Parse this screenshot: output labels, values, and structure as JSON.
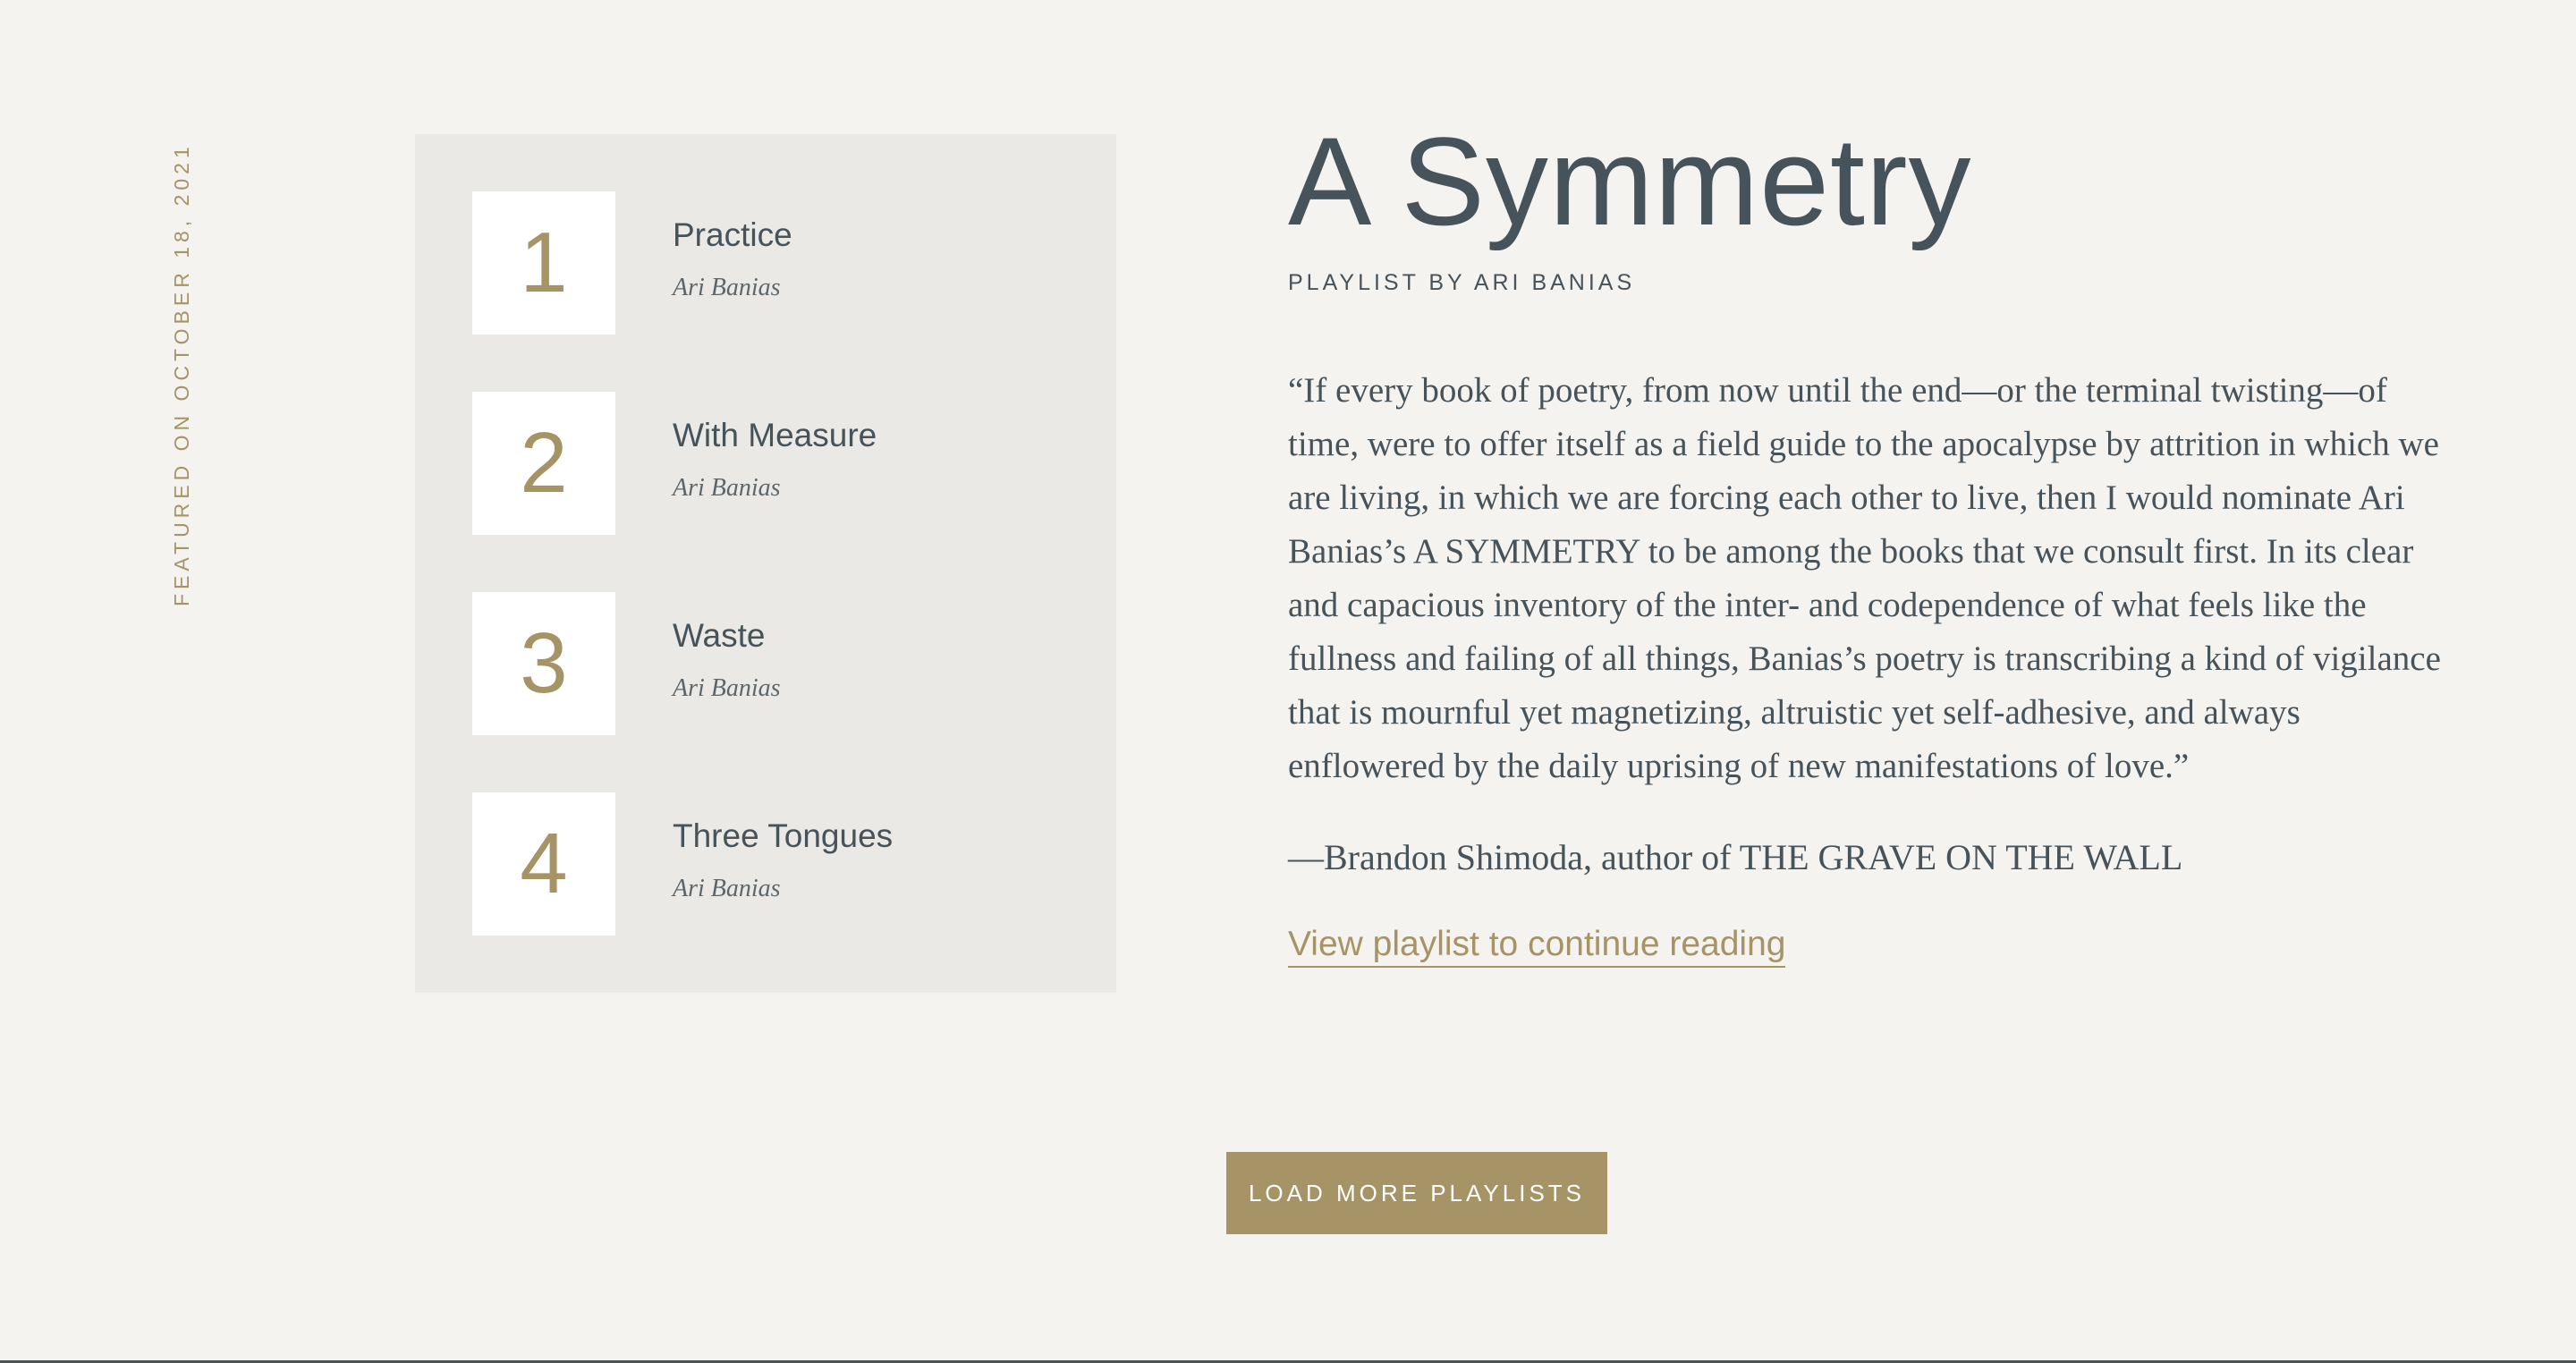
{
  "sidebar": {
    "featured_date": "FEATURED ON OCTOBER 18, 2021"
  },
  "playlist": {
    "items": [
      {
        "number": "1",
        "title": "Practice",
        "author": "Ari Banias"
      },
      {
        "number": "2",
        "title": "With Measure",
        "author": "Ari Banias"
      },
      {
        "number": "3",
        "title": "Waste",
        "author": "Ari Banias"
      },
      {
        "number": "4",
        "title": "Three Tongues",
        "author": "Ari Banias"
      }
    ]
  },
  "main": {
    "title": "A Symmetry",
    "byline": "PLAYLIST BY ARI BANIAS",
    "quote": "“If every book of poetry, from now until the end—or the terminal twisting—of time, were to offer itself as a field guide to the apocalypse by attrition in which we are living, in which we are forcing each other to live, then I would nominate Ari Banias’s A SYMMETRY to be among the books that we consult first. In its clear and capacious inventory of the inter- and codependence of what feels like the fullness and failing of all things, Banias’s poetry is transcribing a kind of vigilance that is mournful yet magnetizing, altruistic yet self-adhesive, and always enflowered by the daily uprising of new manifestations of love.”",
    "attribution": "—Brandon Shimoda, author of THE GRAVE ON THE WALL",
    "link_label": "View playlist to continue reading"
  },
  "actions": {
    "load_more_label": "LOAD MORE PLAYLISTS"
  },
  "colors": {
    "background": "#f4f3f0",
    "panel": "#eae9e5",
    "accent_gold": "#a69466",
    "text_slate": "#47535a"
  }
}
